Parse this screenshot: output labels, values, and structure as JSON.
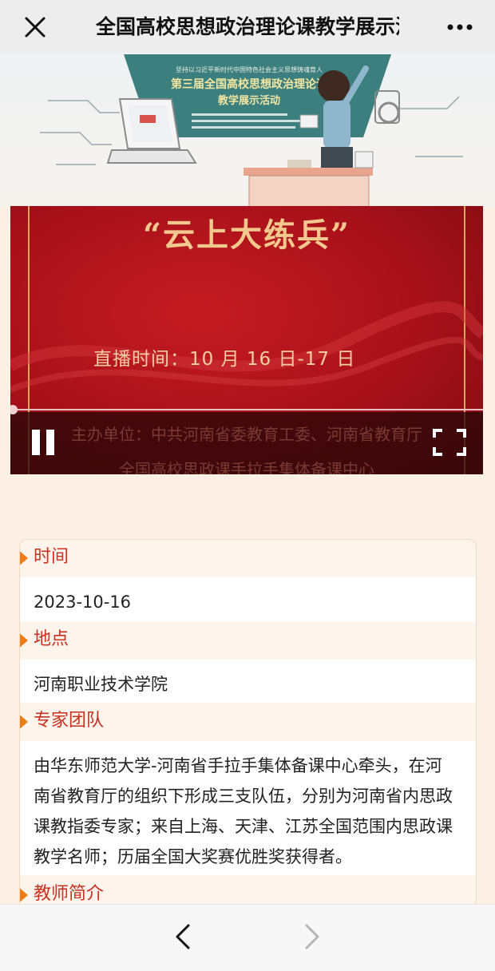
{
  "header": {
    "title": "全国高校思想政治理论课教学展示活动"
  },
  "banner": {
    "tagline": "坚持以习近平新时代中国特色社会主义思想铸魂育人",
    "title_line1": "第三届全国高校思想政治理论课",
    "title_line2": "教学展示活动"
  },
  "video": {
    "heading": "“云上大练兵”",
    "live_time": "直播时间：10 月 16 日-17 日",
    "host_line1": "主办单位：中共河南省委教育工委、河南省教育厅",
    "host_line2": "全国高校思政课手拉手集体备课中心",
    "progress": 0.0
  },
  "sections": [
    {
      "label": "时间",
      "body": "2023-10-16"
    },
    {
      "label": "地点",
      "body": "河南职业技术学院"
    },
    {
      "label": "专家团队",
      "body": "由华东师范大学-河南省手拉手集体备课中心牵头，在河南省教育厅的组织下形成三支队伍，分别为河南省内思政课教指委专家；来自上海、天津、江苏全国范围内思政课教学名师；历届全国大奖赛优胜奖获得者。"
    },
    {
      "label": "教师简介",
      "body": ""
    }
  ],
  "colors": {
    "accent": "#c8311f",
    "marker": "#ef7d16",
    "page_bg": "#fcefe3",
    "video_red": "#a8111a"
  },
  "icons": {
    "close": "close-icon",
    "more": "more-icon",
    "pause": "pause-icon",
    "fullscreen": "fullscreen-icon",
    "back": "chevron-left-icon",
    "forward": "chevron-right-icon"
  }
}
